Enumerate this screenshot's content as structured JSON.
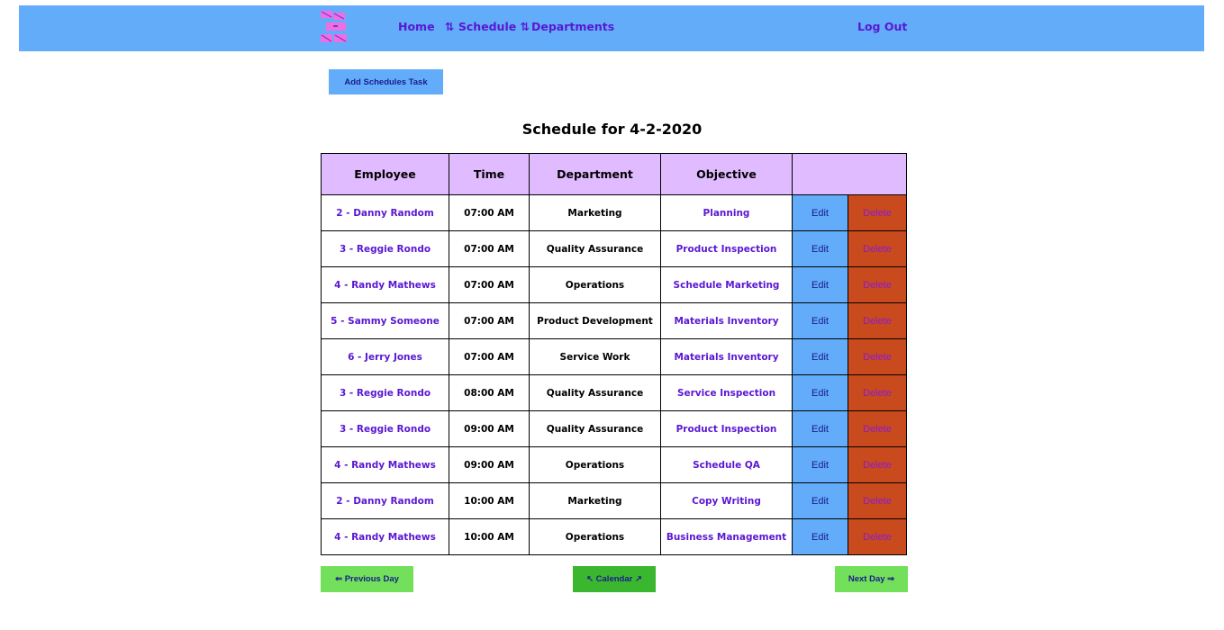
{
  "nav": {
    "home": "Home",
    "schedule": "⇅ Schedule ⇅",
    "departments": "Departments",
    "logout": "Log Out"
  },
  "add_button": "Add Schedules Task",
  "page_title": "Schedule for 4-2-2020",
  "table": {
    "headers": [
      "Employee",
      "Time",
      "Department",
      "Objective"
    ],
    "edit_label": "Edit",
    "delete_label": "Delete",
    "rows": [
      {
        "employee": "2 - Danny Random",
        "time": "07:00 AM",
        "department": "Marketing",
        "objective": "Planning"
      },
      {
        "employee": "3 - Reggie Rondo",
        "time": "07:00 AM",
        "department": "Quality Assurance",
        "objective": "Product Inspection"
      },
      {
        "employee": "4 - Randy Mathews",
        "time": "07:00 AM",
        "department": "Operations",
        "objective": "Schedule Marketing"
      },
      {
        "employee": "5 - Sammy Someone",
        "time": "07:00 AM",
        "department": "Product Development",
        "objective": "Materials Inventory"
      },
      {
        "employee": "6 - Jerry Jones",
        "time": "07:00 AM",
        "department": "Service Work",
        "objective": "Materials Inventory"
      },
      {
        "employee": "3 - Reggie Rondo",
        "time": "08:00 AM",
        "department": "Quality Assurance",
        "objective": "Service Inspection"
      },
      {
        "employee": "3 - Reggie Rondo",
        "time": "09:00 AM",
        "department": "Quality Assurance",
        "objective": "Product Inspection"
      },
      {
        "employee": "4 - Randy Mathews",
        "time": "09:00 AM",
        "department": "Operations",
        "objective": "Schedule QA"
      },
      {
        "employee": "2 - Danny Random",
        "time": "10:00 AM",
        "department": "Marketing",
        "objective": "Copy Writing"
      },
      {
        "employee": "4 - Randy Mathews",
        "time": "10:00 AM",
        "department": "Operations",
        "objective": "Business Management"
      }
    ]
  },
  "footer": {
    "prev": "⇐ Previous Day",
    "calendar": "↖ Calendar ↗",
    "next": "Next Day ⇒"
  },
  "colors": {
    "navbar": "#62acfa",
    "link": "#5a17d2",
    "header_bg": "#e1bbff",
    "edit_bg": "#62acfa",
    "delete_bg": "#c94a1c",
    "green": "#72e05a",
    "dark_green": "#3bb72f"
  },
  "icons": {
    "logo": "pink-bricks-logo"
  }
}
